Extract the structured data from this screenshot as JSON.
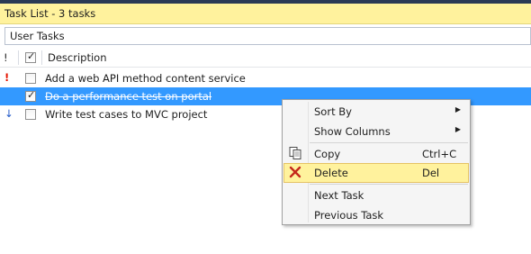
{
  "window": {
    "title": "Task List - 3 tasks"
  },
  "filter": {
    "value": "User Tasks"
  },
  "columns": {
    "priority": "!",
    "description": "Description"
  },
  "tasks": [
    {
      "priority": "!",
      "priority_level": "high",
      "checked": false,
      "description": "Add a web API method content service",
      "selected": false
    },
    {
      "priority": "",
      "priority_level": "normal",
      "checked": true,
      "description": "Do a performance test on portal",
      "selected": true
    },
    {
      "priority": "↓",
      "priority_level": "low",
      "checked": false,
      "description": "Write test cases to MVC project",
      "selected": false
    }
  ],
  "context_menu": {
    "sort_by": "Sort By",
    "show_columns": "Show Columns",
    "copy": "Copy",
    "copy_shortcut": "Ctrl+C",
    "delete": "Delete",
    "delete_shortcut": "Del",
    "next_task": "Next Task",
    "previous_task": "Previous Task",
    "submenu_arrow": "▶"
  },
  "icons": {
    "copy": "copy-icon",
    "delete": "delete-x-icon",
    "check": "✓"
  },
  "colors": {
    "title_bg": "#fff29d",
    "selection": "#3399ff",
    "hot_item": "#fff29d",
    "high_priority": "#e51400",
    "low_priority": "#1e57c8",
    "delete_icon": "#c4281c"
  }
}
